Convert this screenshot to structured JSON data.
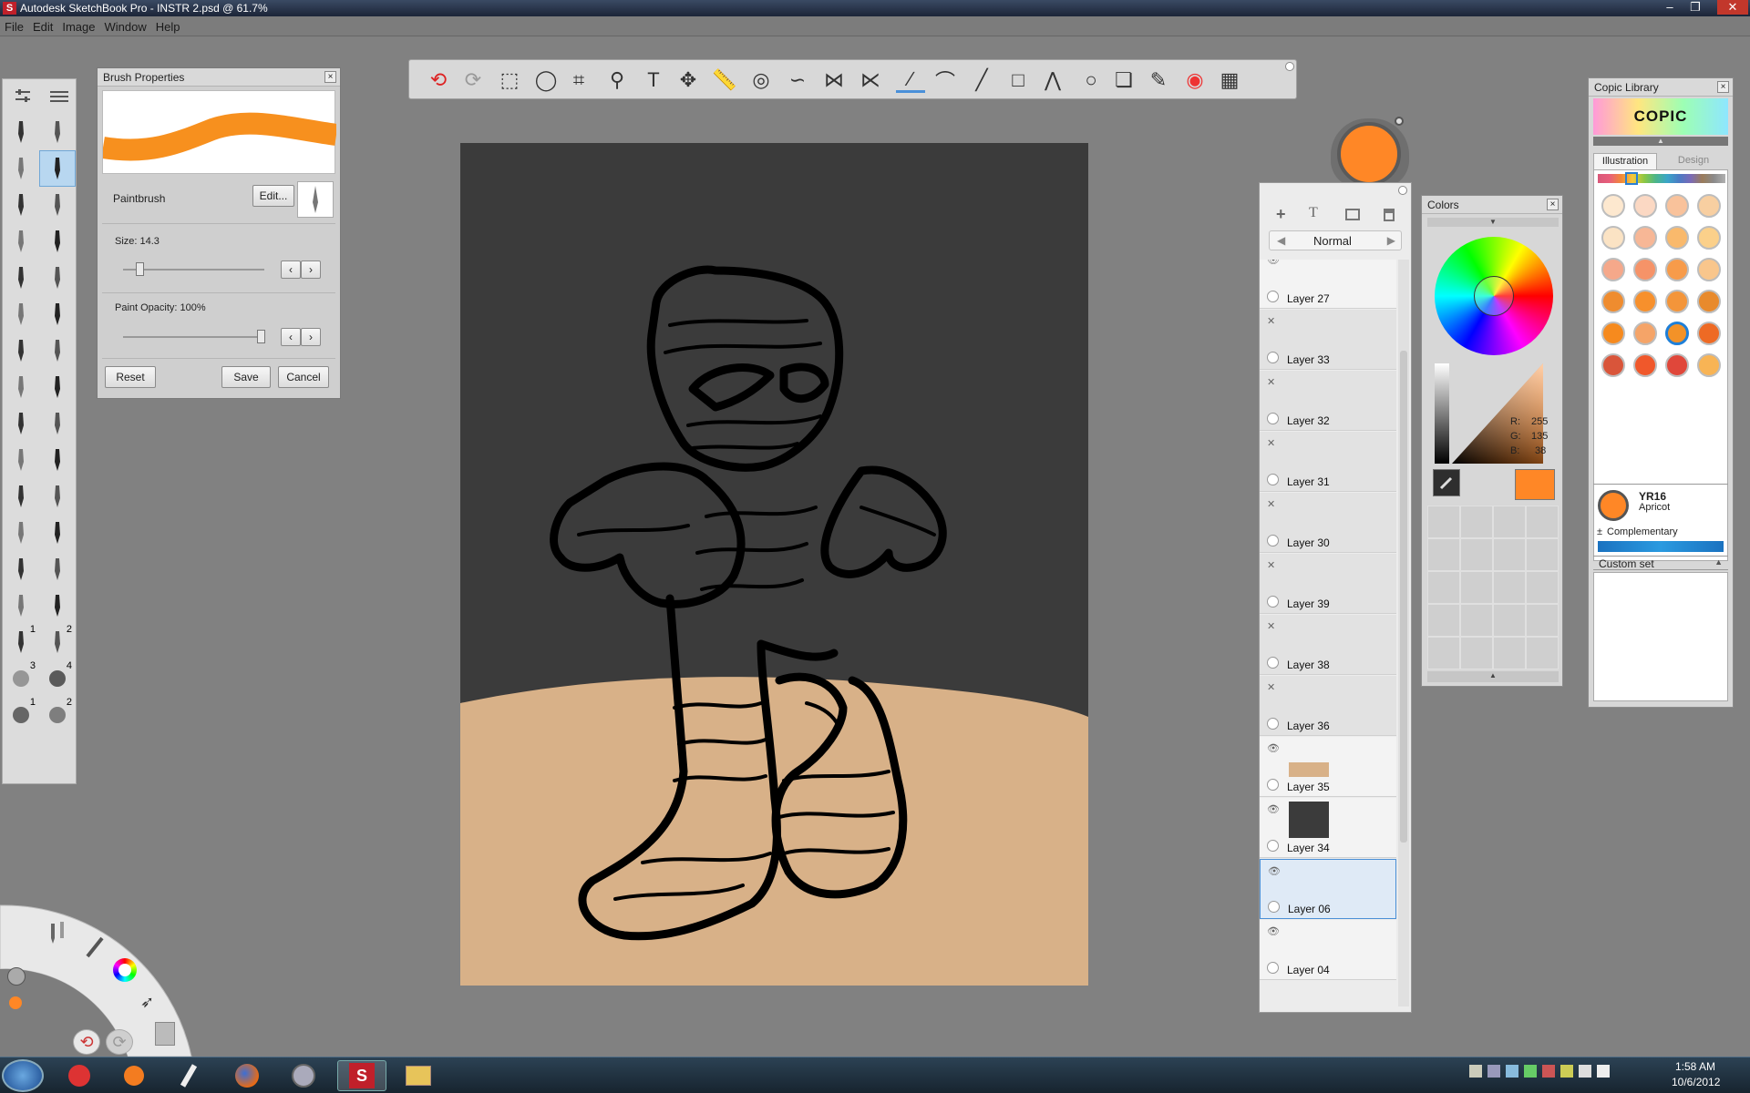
{
  "window": {
    "title": "Autodesk SketchBook Pro - INSTR 2.psd @ 61.7%",
    "minimize": "‒",
    "maximize": "❐",
    "close": "✕"
  },
  "menu": [
    "File",
    "Edit",
    "Image",
    "Window",
    "Help"
  ],
  "brush_props": {
    "title": "Brush Properties",
    "brush_name": "Paintbrush",
    "edit_label": "Edit...",
    "size_label": "Size: 14.3",
    "size_value": 14.3,
    "opacity_label": "Paint Opacity: 100%",
    "opacity_value": 1.0,
    "reset_label": "Reset",
    "save_label": "Save",
    "cancel_label": "Cancel",
    "stroke_color": "#f7901e"
  },
  "brush_palette": {
    "numbers": [
      "1",
      "2",
      "3",
      "4",
      "1",
      "2"
    ]
  },
  "toolbar": {
    "tools": [
      "undo-icon",
      "redo-icon",
      "rect-select-icon",
      "lasso-icon",
      "crop-icon",
      "zoom-icon",
      "text-icon",
      "move-icon",
      "ruler-icon",
      "ellipse-guide-icon",
      "french-curve-icon",
      "symmetry-x-icon",
      "symmetry-y-icon",
      "stroke-smoothing-icon",
      "curve-icon",
      "line-icon",
      "rectangle-icon",
      "polyline-icon",
      "ellipse-icon",
      "layer-editor-icon",
      "brush-palette-icon",
      "color-wheel-icon",
      "copic-icon"
    ],
    "active_tool": "stroke-smoothing-icon"
  },
  "current_color": "#ff8726",
  "layers": {
    "blend_mode": "Normal",
    "items": [
      {
        "name": "Layer 27",
        "visible": true
      },
      {
        "name": "Layer 33",
        "visible": false
      },
      {
        "name": "Layer 32",
        "visible": false
      },
      {
        "name": "Layer 31",
        "visible": false
      },
      {
        "name": "Layer 30",
        "visible": false
      },
      {
        "name": "Layer 39",
        "visible": false
      },
      {
        "name": "Layer 38",
        "visible": false
      },
      {
        "name": "Layer 36",
        "visible": false
      },
      {
        "name": "Layer 35",
        "visible": true
      },
      {
        "name": "Layer 34",
        "visible": true
      },
      {
        "name": "Layer 06",
        "visible": true,
        "selected": true
      },
      {
        "name": "Layer 04",
        "visible": true
      }
    ]
  },
  "colors_panel": {
    "title": "Colors",
    "r_label": "R:",
    "g_label": "G:",
    "b_label": "B:",
    "r": "255",
    "g": "135",
    "b": "38"
  },
  "copic": {
    "title": "Copic Library",
    "logo": "COPIC",
    "tab_illustration": "Illustration",
    "tab_design": "Design",
    "swatches": [
      "#fde8cf",
      "#fbd8c3",
      "#f9c29b",
      "#f8cfa1",
      "#fbe3c4",
      "#f7b796",
      "#f9b96c",
      "#fbd08a",
      "#f5a88a",
      "#f69368",
      "#f79b4a",
      "#f9c68c",
      "#ef8c2f",
      "#f7902c",
      "#f3953a",
      "#e88a2c",
      "#f68a1e",
      "#f5a468",
      "#f39228",
      "#ee6a24",
      "#d9553a",
      "#f0582b",
      "#e0473a",
      "#f8b455"
    ],
    "selected_index": 18,
    "selected_code": "YR16",
    "selected_name": "Apricot",
    "complementary_label": "Complementary",
    "custom_set_label": "Custom set"
  },
  "taskbar": {
    "time": "1:58 AM",
    "date": "10/6/2012"
  }
}
